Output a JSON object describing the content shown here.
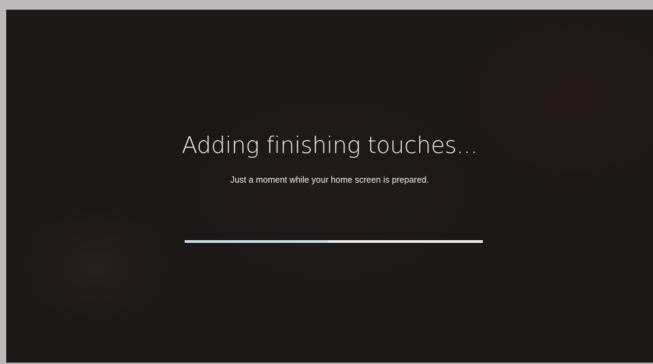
{
  "setup_screen": {
    "title": "Adding finishing touches...",
    "subtitle": "Just a moment while your home screen is prepared.",
    "progress": {
      "fraction": 0.48,
      "fill_color": "#bfe0e4",
      "track_color": "#e8e8e8"
    }
  },
  "colors": {
    "background": "#1c1817",
    "text": "#f2f2f2",
    "frame": "#b9b9b9"
  }
}
